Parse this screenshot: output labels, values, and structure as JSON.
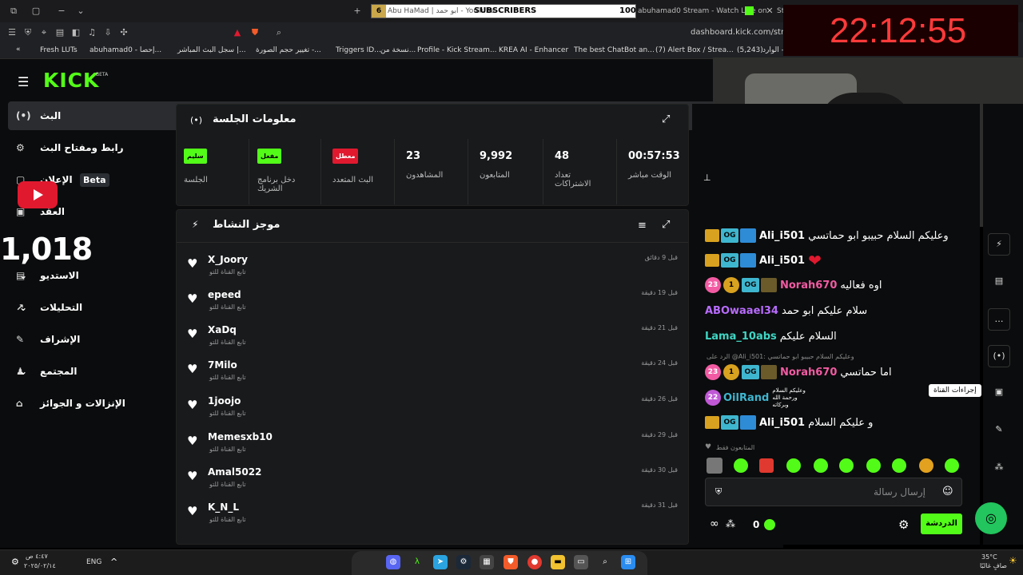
{
  "browser": {
    "tab_counter": "6",
    "tab_left_text": "Abu HaMad | ابو حمد - YouTube",
    "tab_subscribers_label": "SUBSCRIBERS",
    "tab_subscribers_count": "100",
    "tab_stream_text": "abuhamad0 Stream - Watch Live on",
    "tab_st": "St",
    "url": "dashboard.kick.com/stream",
    "bookmarks": [
      "Fresh LUTs",
      "abuhamad0 - إحصا...",
      "سجل البث المباشر |...",
      "تغيير حجم الصورة -...",
      "Triggers ID...",
      "نسخة من...",
      "Profile - Kick Stream...",
      "KREA AI - Enhancer",
      "The best ChatBot an...",
      "(7) Alert Box / Strea...",
      "(5,243)",
      "الوارد - ..."
    ]
  },
  "clock": "22:12:55",
  "overlay_count": "1,018",
  "brand": {
    "logo": "KICK",
    "beta": "BETA"
  },
  "nav": {
    "items": [
      {
        "label": "البث",
        "icon": "(•)"
      },
      {
        "label": "رابط ومفتاح البث",
        "icon": "⚙"
      },
      {
        "label": "الإعلان",
        "icon": "▢",
        "badge": "Beta"
      },
      {
        "label": "العقد",
        "icon": "▣"
      },
      {
        "label": "الاستديو",
        "icon": "▤"
      },
      {
        "label": "التحليلات",
        "icon": "↗"
      },
      {
        "label": "الإشراف",
        "icon": "✎"
      },
      {
        "label": "المجتمع",
        "icon": "♟"
      },
      {
        "label": "الإنزالات و الجوائز",
        "icon": "⌂"
      }
    ]
  },
  "session": {
    "title": "معلومات الجلسة",
    "stats": [
      {
        "badge": "سليم",
        "label": "الجلسة",
        "color": "#53fc18"
      },
      {
        "badge": "مفعل",
        "label": "دخل برنامج الشريك",
        "color": "#53fc18"
      },
      {
        "badge": "معطل",
        "label": "البث المتعدد",
        "color": "#e0192f"
      },
      {
        "value": "23",
        "label": "المشاهدون"
      },
      {
        "value": "9,992",
        "label": "المتابعون"
      },
      {
        "value": "48",
        "label": "تعداد الاشتراكات"
      },
      {
        "value": "00:57:53",
        "label": "الوقت مباشر"
      }
    ]
  },
  "activity": {
    "title": "موجز النشاط",
    "items": [
      {
        "name": "X_Joory",
        "sub": "تابع القناة للتو",
        "time": "قبل 9 دقائق"
      },
      {
        "name": "epeed",
        "sub": "تابع القناة للتو",
        "time": "قبل 19 دقيقة"
      },
      {
        "name": "XaDq",
        "sub": "تابع القناة للتو",
        "time": "قبل 21 دقيقة"
      },
      {
        "name": "7Milo",
        "sub": "تابع القناة للتو",
        "time": "قبل 24 دقيقة"
      },
      {
        "name": "1joojo",
        "sub": "تابع القناة للتو",
        "time": "قبل 26 دقيقة"
      },
      {
        "name": "Memesxb10",
        "sub": "تابع القناة للتو",
        "time": "قبل 29 دقيقة"
      },
      {
        "name": "Amal5022",
        "sub": "تابع القناة للتو",
        "time": "قبل 30 دقيقة"
      },
      {
        "name": "K_N_L",
        "sub": "تابع القناة للتو",
        "time": "قبل 31 دقيقة"
      }
    ]
  },
  "chat": {
    "messages": [
      {
        "user": "Ali_i501",
        "text": "وعليكم السلام حبيبو ابو حماتسي",
        "color": "#ffffff"
      },
      {
        "user": "Ali_i501",
        "text": "❤",
        "color": "#ffffff"
      },
      {
        "user": "Norah670",
        "text": "اوه فعاليه",
        "color": "#f25ba3",
        "count": "23",
        "gold": "1"
      },
      {
        "user": "ABOwaael34",
        "text": "سلام عليكم ابو حمد",
        "color": "#b86cff"
      },
      {
        "user": "Lama_10abs",
        "text": "السلام عليكم",
        "color": "#3fd6c4"
      },
      {
        "user": "Norah670",
        "text": "اما حماتسي",
        "color": "#f25ba3",
        "count": "23",
        "gold": "1"
      },
      {
        "user": "OilRand",
        "text": "وعليكم السلام ورحمة الله وبركاته",
        "color": "#3fb6cf",
        "count": "22"
      },
      {
        "user": "Ali_i501",
        "text": "و عليكم السلام",
        "color": "#ffffff"
      }
    ],
    "reply_hint": "الرد على @Ali_i501: وعليكم السلام حبيبو ابو حماتسي",
    "followers_only": "المتابعون فقط",
    "input_placeholder": "إرسال رسالة",
    "send_label": "الدردشة",
    "points": "0",
    "tooltip": "إجراءات القناة"
  },
  "taskbar": {
    "time": "٤:٤٧ ص",
    "date": "٢٠٢٥/٠٢/١٤",
    "lang": "ENG",
    "weather_temp": "35°C",
    "weather_desc": "صافٍ غالبًا"
  }
}
